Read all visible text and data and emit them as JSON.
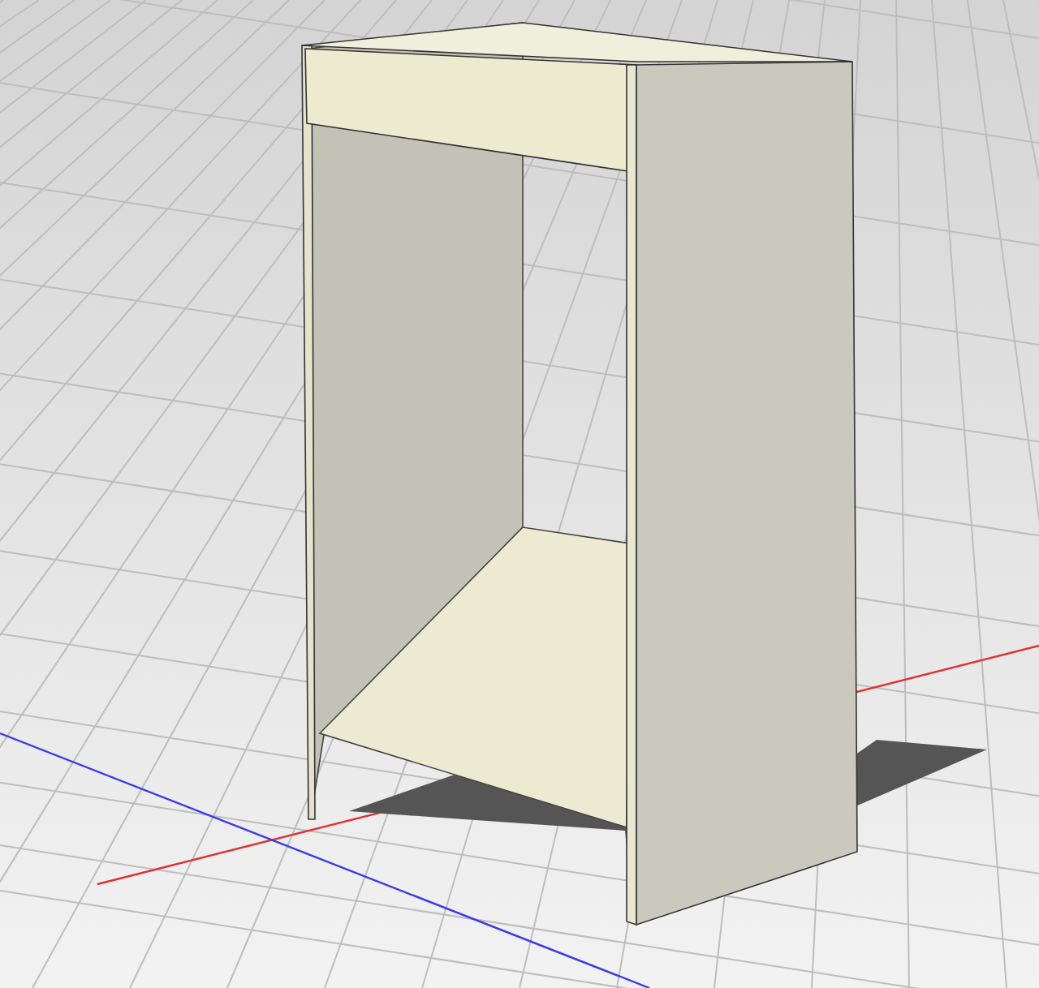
{
  "viewport": {
    "axes": [
      {
        "color": "#e03030"
      },
      {
        "color": "#3a3ae8"
      }
    ]
  }
}
